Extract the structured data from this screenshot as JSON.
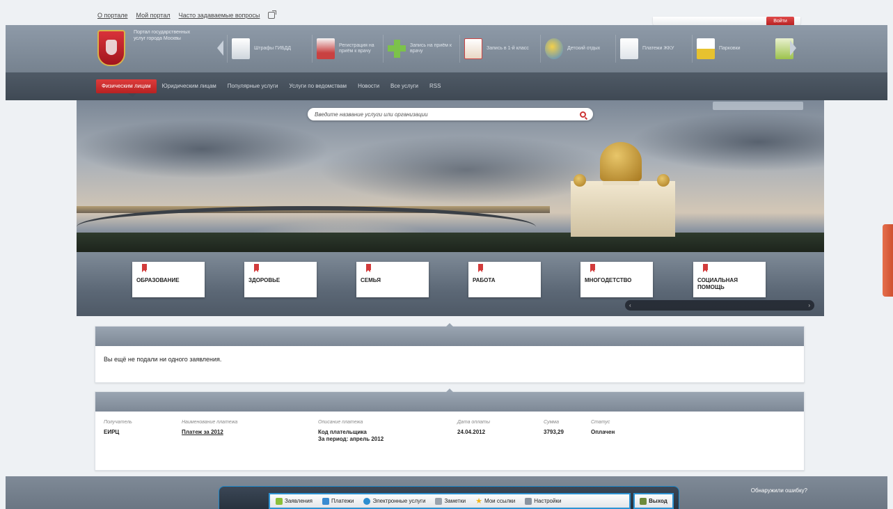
{
  "top_links": [
    "О портале",
    "Мой портал",
    "Часто задаваемые вопросы"
  ],
  "login": {
    "button_label": "Войти"
  },
  "brand": {
    "text": "Портал государственных услуг города Москвы"
  },
  "carousel": [
    {
      "label": "Штрафы ГИБДД"
    },
    {
      "label": "Регистрация на приём к врачу"
    },
    {
      "label": "Запись на приём к врачу"
    },
    {
      "label": "Запись в 1-й класс"
    },
    {
      "label": "Детский отдых"
    },
    {
      "label": "Платежи ЖКУ"
    },
    {
      "label": "Парковки"
    },
    {
      "label": ""
    }
  ],
  "nav": [
    {
      "label": "Физическим лицам",
      "active": true
    },
    {
      "label": "Юридическим лицам",
      "active": false
    },
    {
      "label": "Популярные услуги",
      "active": false
    },
    {
      "label": "Услуги по ведомствам",
      "active": false
    },
    {
      "label": "Новости",
      "active": false
    },
    {
      "label": "Все услуги",
      "active": false
    },
    {
      "label": "RSS",
      "active": false
    }
  ],
  "search": {
    "placeholder": "Введите название услуги или организации"
  },
  "hero_top_right": "",
  "categories": [
    {
      "label": "ОБРАЗОВАНИЕ"
    },
    {
      "label": "ЗДОРОВЬЕ"
    },
    {
      "label": "СЕМЬЯ"
    },
    {
      "label": "РАБОТА"
    },
    {
      "label": "МНОГОДЕТСТВО"
    },
    {
      "label": "СОЦИАЛЬНАЯ ПОМОЩЬ"
    }
  ],
  "photo_caption": "",
  "applications": {
    "title": "",
    "link": "",
    "empty_text": "Вы ещё не подали ни одного заявления."
  },
  "payments": {
    "title": "",
    "link": "",
    "columns": [
      "Получатель",
      "Наименование платежа",
      "Описание платежа",
      "Дата оплаты",
      "Сумма",
      "Статус"
    ],
    "rows": [
      {
        "recipient": "ЕИРЦ",
        "name": "Платеж за 2012",
        "description": [
          "Код плательщика",
          "За период: апрель 2012"
        ],
        "date": "24.04.2012",
        "amount": "3793,29",
        "status": "Оплачен"
      }
    ]
  },
  "footer": {
    "left_lines": [
      "",
      ""
    ],
    "right_title": "Обнаружили ошибку?",
    "right_lines": [
      "",
      ""
    ]
  },
  "toolbar": {
    "left_text": [
      "",
      "",
      ""
    ],
    "items": [
      {
        "label": "Заявления",
        "icon": "document-icon",
        "color": "#8bbf3a"
      },
      {
        "label": "Платежи",
        "icon": "wallet-icon",
        "color": "#3a8bd1"
      },
      {
        "label": "Электронные услуги",
        "icon": "globe-icon",
        "color": "#2d8ed0"
      },
      {
        "label": "Заметки",
        "icon": "note-icon",
        "color": "#9aa3ad"
      },
      {
        "label": "Мои ссылки",
        "icon": "star-icon",
        "color": "#f1b51c"
      },
      {
        "label": "Настройки",
        "icon": "wrench-icon",
        "color": "#8a94a0"
      }
    ],
    "exit_label": "Выход"
  },
  "side_tab": ""
}
